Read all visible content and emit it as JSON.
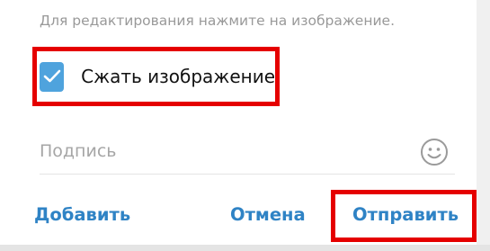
{
  "dialog": {
    "hint": "Для редактирования нажмите на изображение.",
    "compress": {
      "label": "Сжать изображение",
      "checked": true
    },
    "caption": {
      "placeholder": "Подпись",
      "value": ""
    },
    "emoji_icon": "smiley-icon",
    "buttons": {
      "add": "Добавить",
      "cancel": "Отмена",
      "send": "Отправить"
    }
  },
  "colors": {
    "accent": "#2f83c5",
    "checkbox": "#4fa3dd",
    "highlight": "#e50000"
  }
}
